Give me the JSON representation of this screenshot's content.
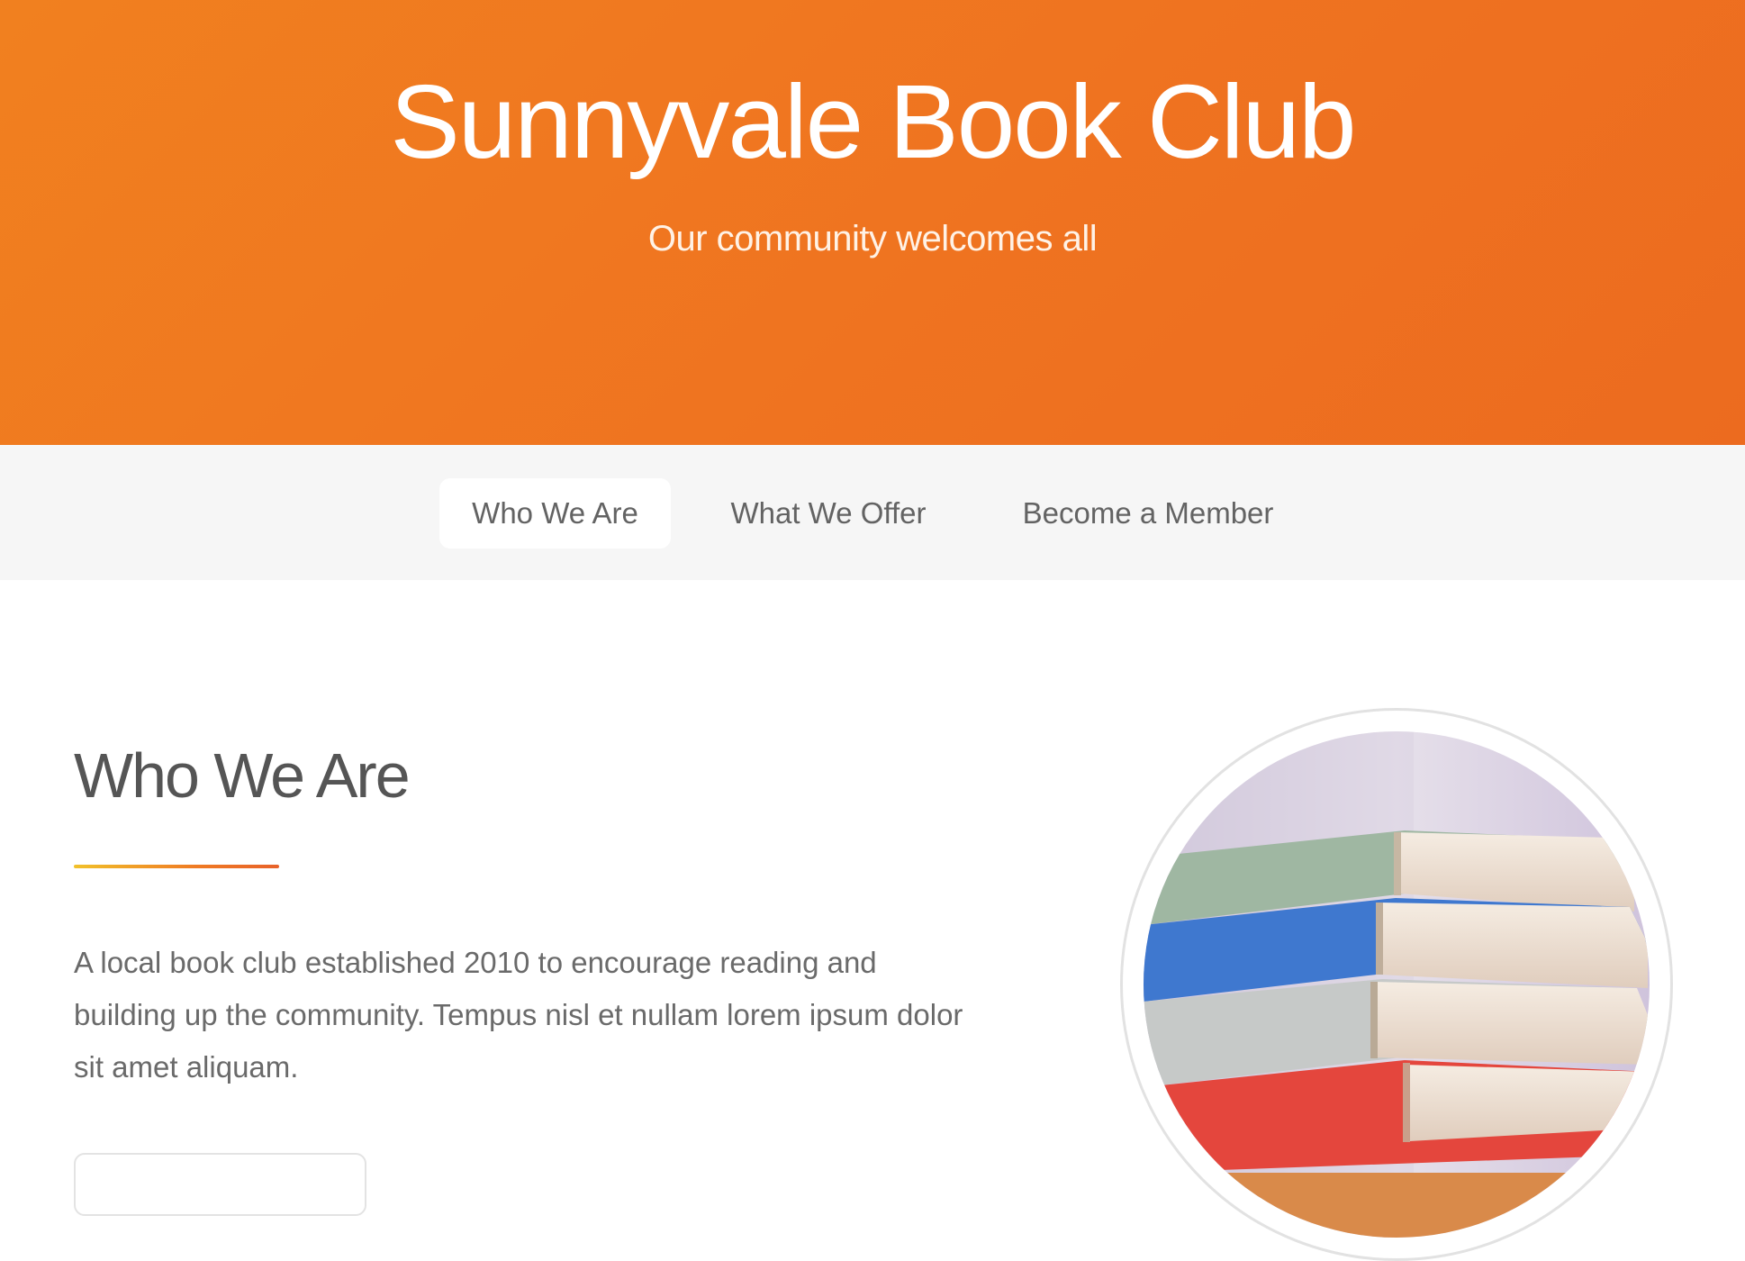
{
  "header": {
    "title": "Sunnyvale Book Club",
    "subtitle": "Our community welcomes all",
    "background_color": "#ef7420"
  },
  "nav": {
    "items": [
      {
        "label": "Who We Are",
        "active": true
      },
      {
        "label": "What We Offer",
        "active": false
      },
      {
        "label": "Become a Member",
        "active": false
      }
    ]
  },
  "intro": {
    "heading": "Who We Are",
    "body": "A local book club established 2010 to encourage reading and building up the community. Tempus nisl et nullam lorem ipsum dolor sit amet aliquam.",
    "accent_colors": [
      "#f1c12a",
      "#e8622a"
    ]
  },
  "image": {
    "icon": "stacked-books-photo"
  }
}
